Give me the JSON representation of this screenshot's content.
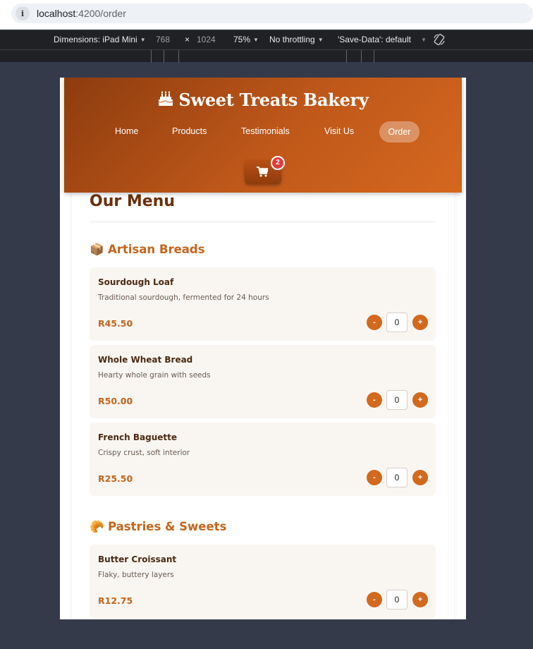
{
  "browser": {
    "url_host": "localhost",
    "url_path": ":4200/order"
  },
  "devtools": {
    "device_label": "Dimensions: iPad Mini",
    "width": "768",
    "times": "×",
    "height": "1024",
    "zoom": "75%",
    "throttling": "No throttling",
    "save_data": "'Save-Data': default"
  },
  "header": {
    "brand": "Sweet Treats Bakery",
    "nav": [
      "Home",
      "Products",
      "Testimonials",
      "Visit Us",
      "Order"
    ],
    "cart_count": "2",
    "accent": "#d2691e"
  },
  "menu": {
    "title": "Our Menu",
    "categories": [
      {
        "icon": "📦",
        "name": "Artisan Breads",
        "items": [
          {
            "name": "Sourdough Loaf",
            "desc": "Traditional sourdough, fermented for 24 hours",
            "price": "R45.50",
            "qty": "0"
          },
          {
            "name": "Whole Wheat Bread",
            "desc": "Hearty whole grain with seeds",
            "price": "R50.00",
            "qty": "0"
          },
          {
            "name": "French Baguette",
            "desc": "Crispy crust, soft interior",
            "price": "R25.50",
            "qty": "0"
          }
        ]
      },
      {
        "icon": "🥐",
        "name": "Pastries & Sweets",
        "items": [
          {
            "name": "Butter Croissant",
            "desc": "Flaky, buttery layers",
            "price": "R12.75",
            "qty": "0"
          }
        ]
      }
    ],
    "minus": "-",
    "plus": "+"
  }
}
